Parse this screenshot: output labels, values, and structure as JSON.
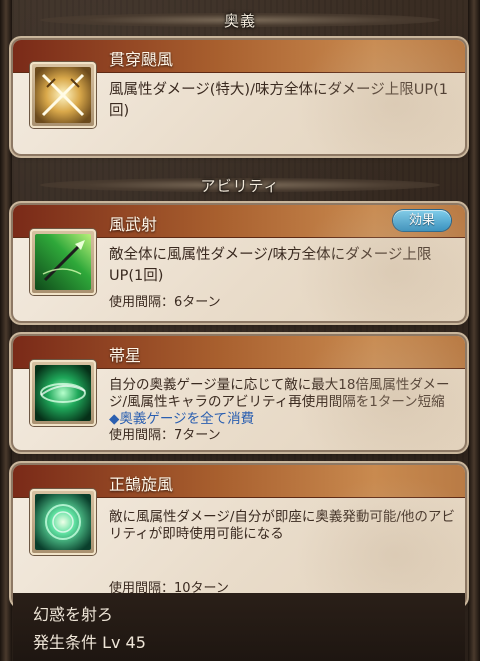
{
  "ougi_section": {
    "title": "奥義"
  },
  "ougi": {
    "name": "貫穿颶風",
    "description": "風属性ダメージ(特大)/味方全体にダメージ上限UP(1回)",
    "icon": "crossed-swords-icon"
  },
  "ability_section": {
    "title": "アビリティ"
  },
  "abilities": [
    {
      "name": "風武射",
      "badge": "効果",
      "description": "敵全体に風属性ダメージ/味方全体にダメージ上限UP(1回)",
      "cooldown": "使用間隔：6ターン",
      "icon": "wind-arrow-icon"
    },
    {
      "name": "帯星",
      "description": "自分の奥義ゲージ量に応じて敵に最大18倍風属性ダメージ/風属性キャラのアビリティ再使用間隔を1ターン短縮",
      "note": "◆奥義ゲージを全て消費",
      "cooldown": "使用間隔：7ターン",
      "icon": "wind-swirl-icon"
    },
    {
      "name": "正鵠旋風",
      "description": "敵に風属性ダメージ/自分が即座に奥義発動可能/他のアビリティが即時使用可能になる",
      "cooldown": "使用間隔：10ターン",
      "icon": "wind-orb-icon"
    }
  ],
  "footer": {
    "skill_name": "幻惑を射ろ",
    "condition": "発生条件 Lv 45"
  }
}
